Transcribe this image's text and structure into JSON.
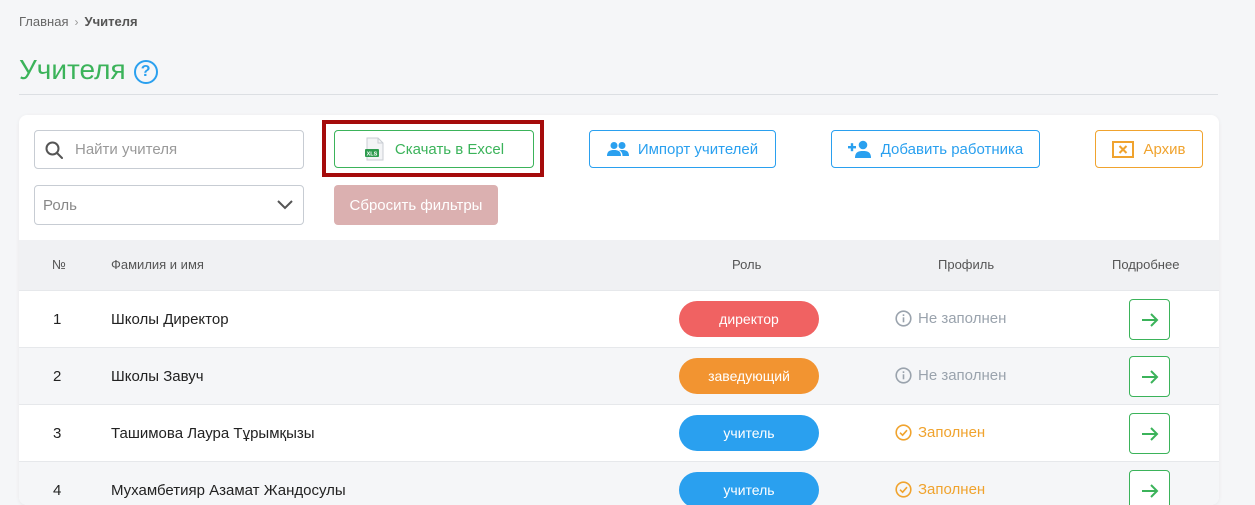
{
  "breadcrumb": {
    "home": "Главная",
    "current": "Учителя"
  },
  "page": {
    "title": "Учителя"
  },
  "filters": {
    "search_placeholder": "Найти учителя",
    "role_placeholder": "Роль",
    "reset_label": "Сбросить фильтры"
  },
  "actions": {
    "excel_label": "Скачать в Excel",
    "excel_icon_text": "XLS",
    "import_label": "Импорт учителей",
    "add_label": "Добавить работника",
    "archive_label": "Архив"
  },
  "table": {
    "headers": {
      "num": "№",
      "name": "Фамилия и имя",
      "role": "Роль",
      "profile": "Профиль",
      "details": "Подробнее"
    },
    "rows": [
      {
        "num": "1",
        "name": "Школы Директор",
        "role": "директор",
        "role_color": "#f06262",
        "profile": "Не заполнен",
        "profile_state": "empty"
      },
      {
        "num": "2",
        "name": "Школы Завуч",
        "role": "заведующий",
        "role_color": "#f29431",
        "profile": "Не заполнен",
        "profile_state": "empty"
      },
      {
        "num": "3",
        "name": "Ташимова Лаура Тұрымқызы",
        "role": "учитель",
        "role_color": "#2aa0ef",
        "profile": "Заполнен",
        "profile_state": "filled"
      },
      {
        "num": "4",
        "name": "Мухамбетияр Азамат Жандосулы",
        "role": "учитель",
        "role_color": "#2aa0ef",
        "profile": "Заполнен",
        "profile_state": "filled"
      }
    ]
  },
  "colors": {
    "accent_green": "#3bb35a",
    "accent_blue": "#2aa0ef",
    "accent_orange": "#f0a32e",
    "highlight": "#a50b0b",
    "muted": "#9aa3ad"
  }
}
